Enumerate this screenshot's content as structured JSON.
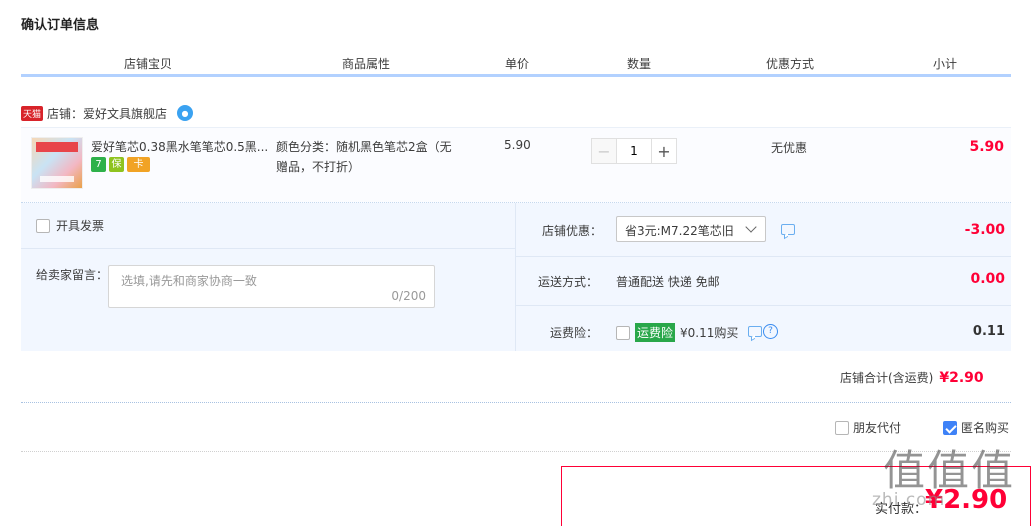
{
  "page": {
    "title": "确认订单信息"
  },
  "columns": [
    "店铺宝贝",
    "商品属性",
    "单价",
    "数量",
    "优惠方式",
    "小计"
  ],
  "shop": {
    "tag": "天猫",
    "label": "店铺：",
    "name": "爱好文具旗舰店",
    "chat_icon": "wangwang-icon"
  },
  "item": {
    "name": "爱好笔芯0.38黑水笔笔芯0.5黑...",
    "badges": [
      "7",
      "保",
      "卡"
    ],
    "attr": "颜色分类：随机黑色笔芯2盒（无赠品，不打折）",
    "price": "5.90",
    "qty": "1",
    "qty_minus": "−",
    "qty_plus": "+",
    "discount": "无优惠",
    "subtotal": "5.90"
  },
  "invoice": {
    "label": "开具发票"
  },
  "message": {
    "label": "给卖家留言：",
    "placeholder": "选填,请先和商家协商一致",
    "count": "0/200"
  },
  "shop_discount": {
    "label": "店铺优惠：",
    "selected": "省3元:M7.22笔芯旧",
    "amount": "-3.00"
  },
  "shipping": {
    "label": "运送方式：",
    "value": "普通配送 快递 免邮",
    "amount": "0.00"
  },
  "insurance": {
    "label": "运费险：",
    "tag": "运费险",
    "value": "¥0.11购买",
    "amount": "0.11"
  },
  "shop_total": {
    "label": "店铺合计(含运费)",
    "amount": "¥2.90"
  },
  "options": {
    "friend_pay": "朋友代付",
    "anonymous": "匿名购买"
  },
  "payment": {
    "label": "实付款：",
    "amount": "¥2.90"
  },
  "watermark": {
    "text": "值值值",
    "url": "zhi.com"
  }
}
